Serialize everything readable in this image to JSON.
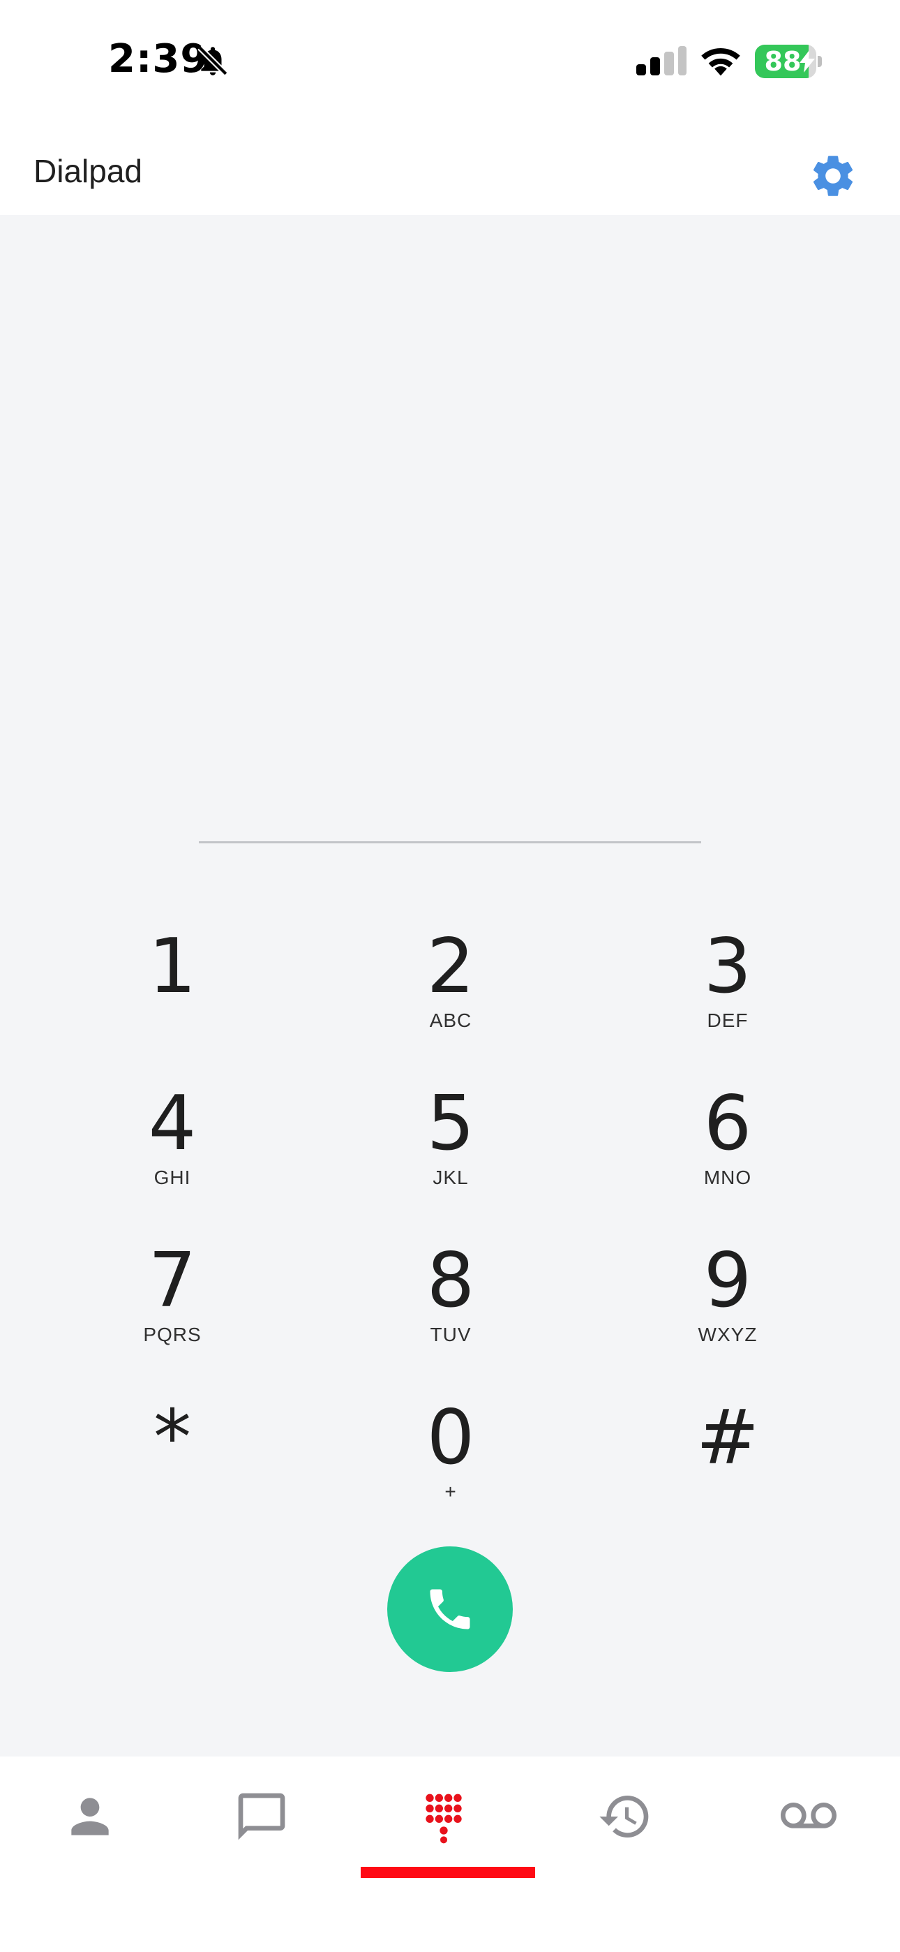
{
  "status_bar": {
    "time": "2:39",
    "battery_percent": "88",
    "battery_level": 0.88,
    "icons": [
      "bell-slash-icon",
      "cellular-signal-icon",
      "wifi-icon",
      "battery-charging-icon"
    ]
  },
  "header": {
    "title": "Dialpad",
    "settings_icon": "gear-icon",
    "accent_color": "#4a90e2"
  },
  "dialer": {
    "number": "",
    "keys": [
      {
        "digit": "1",
        "letters": ""
      },
      {
        "digit": "2",
        "letters": "ABC"
      },
      {
        "digit": "3",
        "letters": "DEF"
      },
      {
        "digit": "4",
        "letters": "GHI"
      },
      {
        "digit": "5",
        "letters": "JKL"
      },
      {
        "digit": "6",
        "letters": "MNO"
      },
      {
        "digit": "7",
        "letters": "PQRS"
      },
      {
        "digit": "8",
        "letters": "TUV"
      },
      {
        "digit": "9",
        "letters": "WXYZ"
      },
      {
        "digit": "*",
        "letters": ""
      },
      {
        "digit": "0",
        "letters": "+"
      },
      {
        "digit": "#",
        "letters": ""
      }
    ],
    "call_icon": "phone-icon",
    "call_color": "#22c993"
  },
  "bottom_nav": {
    "items": [
      {
        "icon": "contacts-person-icon",
        "active": false
      },
      {
        "icon": "messages-chat-icon",
        "active": false
      },
      {
        "icon": "dialpad-icon",
        "active": true
      },
      {
        "icon": "call-history-icon",
        "active": false
      },
      {
        "icon": "voicemail-icon",
        "active": false
      }
    ],
    "active_color": "#ff0a14",
    "inactive_color": "#8e8e93"
  }
}
